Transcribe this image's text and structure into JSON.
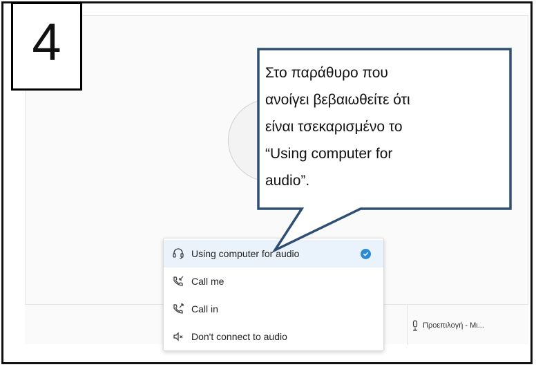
{
  "step": {
    "number": "4"
  },
  "callout": {
    "text": "Στο παράθυρο που\nανοίγει  βεβαιωθείτε  ότι\nείναι τσεκαρισμένο το\n“Using computer for\naudio”."
  },
  "audio_menu": {
    "items": [
      {
        "label": "Using computer for audio",
        "icon": "headset-icon",
        "selected": true
      },
      {
        "label": "Call me",
        "icon": "call-me-icon",
        "selected": false
      },
      {
        "label": "Call in",
        "icon": "call-in-icon",
        "selected": false
      },
      {
        "label": "Don't connect to audio",
        "icon": "speaker-mute-icon",
        "selected": false
      }
    ]
  },
  "bottom_bar": {
    "microphone_label": "Προεπιλογή - Μι..."
  },
  "colors": {
    "callout_border": "#2f4f72",
    "selected_bg": "#eaf2fb",
    "check": "#2a8ad4"
  }
}
